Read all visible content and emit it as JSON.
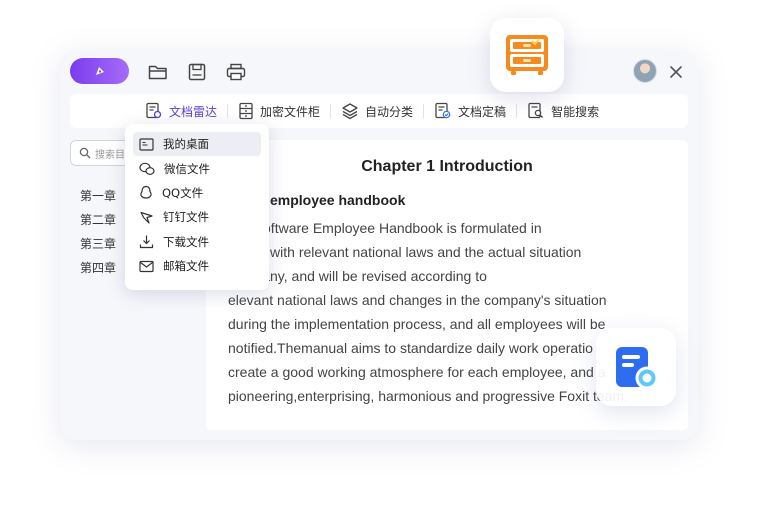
{
  "toolbar": {
    "items": [
      {
        "label": "文档雷达",
        "icon": "doc-radar-icon"
      },
      {
        "label": "加密文件柜",
        "icon": "cabinet-icon"
      },
      {
        "label": "自动分类",
        "icon": "layers-icon"
      },
      {
        "label": "文档定稿",
        "icon": "doc-finalize-icon"
      },
      {
        "label": "智能搜索",
        "icon": "smart-search-icon"
      }
    ],
    "active_color": "#5a3fd6"
  },
  "sidebar": {
    "search_placeholder": "搜索目",
    "chapters": [
      "第一章",
      "第二章",
      "第三章",
      "第四章"
    ]
  },
  "dropdown": {
    "items": [
      {
        "label": "我的桌面",
        "icon": "desktop-icon",
        "highlighted": true
      },
      {
        "label": "微信文件",
        "icon": "wechat-icon"
      },
      {
        "label": "QQ文件",
        "icon": "qq-icon"
      },
      {
        "label": "钉钉文件",
        "icon": "dingtalk-icon"
      },
      {
        "label": "下载文件",
        "icon": "download-icon"
      },
      {
        "label": "邮箱文件",
        "icon": "mail-icon"
      }
    ]
  },
  "document": {
    "title": "Chapter 1 Introduction",
    "subtitle": "ut the employee handbook",
    "lines": [
      "oxit Software Employee Handbook is formulated in",
      "dance with relevant national laws and the actual situation",
      "company, and will be revised according to",
      "elevant national laws and changes in the company's situation",
      "during the implementation process, and all employees will be",
      "notified.Themanual aims to standardize daily work operatio",
      "create a good working atmosphere for each employee, and a",
      "pioneering,enterprising, harmonious and progressive Foxit team."
    ]
  },
  "colors": {
    "brand_purple": "#7a3df0",
    "cabinet_orange": "#f58a1f",
    "search_blue": "#2f6df0"
  }
}
